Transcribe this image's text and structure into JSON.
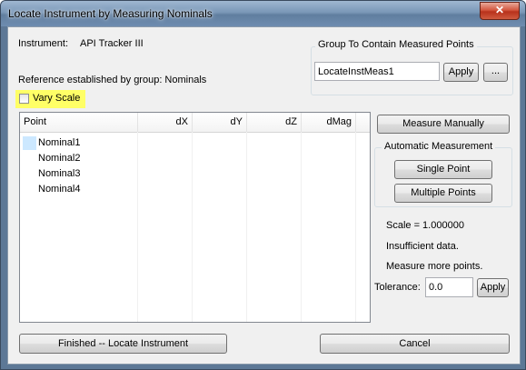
{
  "window": {
    "title": "Locate Instrument by Measuring Nominals",
    "close_glyph": "✕"
  },
  "instrument": {
    "label": "Instrument:",
    "value": "API Tracker III"
  },
  "reference_text": "Reference established by group: Nominals",
  "vary_scale": {
    "label": "Vary Scale",
    "checked": false,
    "highlight_color": "#ffff66"
  },
  "group_contain": {
    "title": "Group To Contain Measured Points",
    "input_value": "LocateInstMeas1",
    "apply_label": "Apply",
    "browse_label": "..."
  },
  "table": {
    "columns": [
      "Point",
      "dX",
      "dY",
      "dZ",
      "dMag"
    ],
    "rows": [
      {
        "name": "Nominal1",
        "selected": true
      },
      {
        "name": "Nominal2",
        "selected": false
      },
      {
        "name": "Nominal3",
        "selected": false
      },
      {
        "name": "Nominal4",
        "selected": false
      }
    ]
  },
  "measure_manually_label": "Measure Manually",
  "auto_measure": {
    "title": "Automatic Measurement",
    "single_point_label": "Single Point",
    "multiple_points_label": "Multiple Points"
  },
  "status": {
    "scale_text": "Scale = 1.000000",
    "insufficient_text": "Insufficient data.",
    "measure_more_text": "Measure more points."
  },
  "tolerance": {
    "label": "Tolerance:",
    "value": "0.0",
    "apply_label": "Apply"
  },
  "finished_label": "Finished -- Locate Instrument",
  "cancel_label": "Cancel"
}
